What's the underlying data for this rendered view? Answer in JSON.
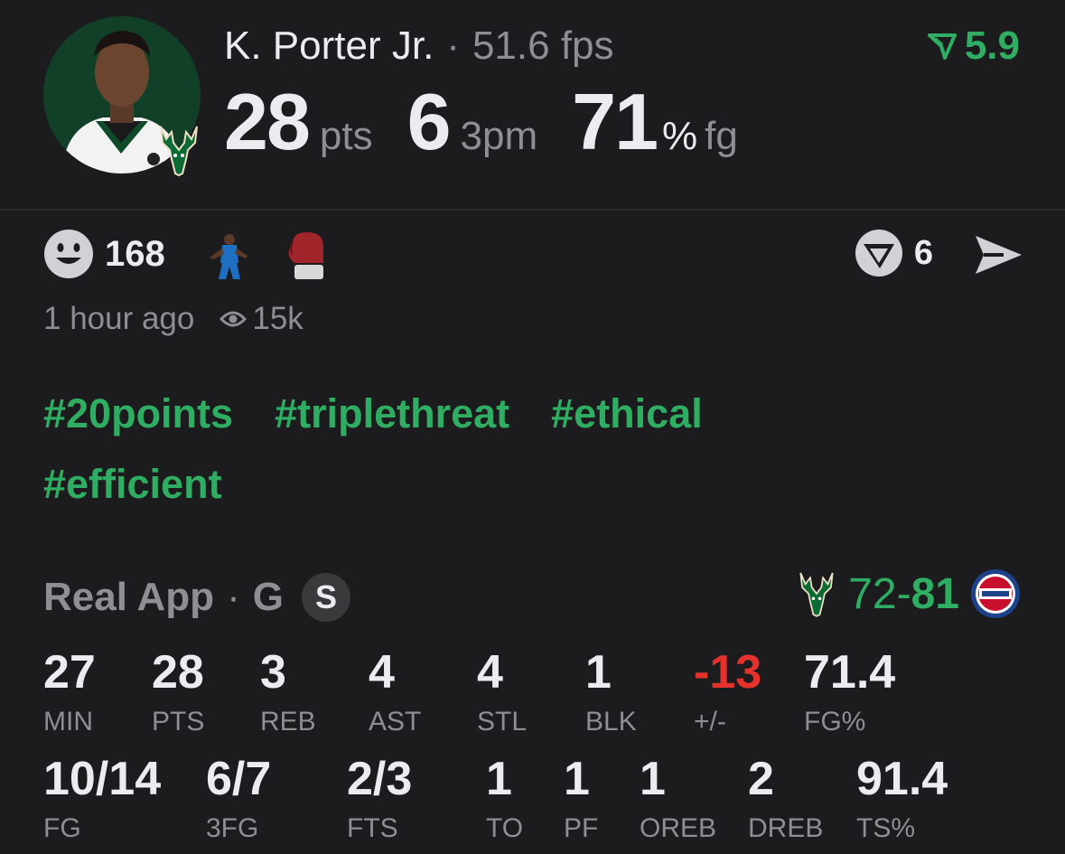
{
  "player": {
    "name": "K. Porter Jr.",
    "fps": "51.6 fps"
  },
  "rating": "5.9",
  "headline": {
    "pts_value": "28",
    "pts_unit": "pts",
    "threes_value": "6",
    "threes_unit": "3pm",
    "fg_value": "71",
    "fg_pct": "%",
    "fg_unit": "fg"
  },
  "reactions": {
    "count": "168"
  },
  "comments": {
    "count": "6"
  },
  "meta": {
    "time": "1 hour ago",
    "views": "15k"
  },
  "tags": [
    "#20points",
    "#triplethreat",
    "#ethical",
    "#efficient"
  ],
  "game": {
    "source": "Real App",
    "sep": "·",
    "position": "G",
    "badge": "S",
    "score_team": "72",
    "dash": "-",
    "score_opp": "81"
  },
  "stats_row1": [
    {
      "value": "27",
      "label": "MIN"
    },
    {
      "value": "28",
      "label": "PTS"
    },
    {
      "value": "3",
      "label": "REB"
    },
    {
      "value": "4",
      "label": "AST"
    },
    {
      "value": "4",
      "label": "STL"
    },
    {
      "value": "1",
      "label": "BLK"
    },
    {
      "value": "-13",
      "label": "+/-"
    },
    {
      "value": "71.4",
      "label": "FG%"
    }
  ],
  "stats_row2": [
    {
      "value": "10/14",
      "label": "FG"
    },
    {
      "value": "6/7",
      "label": "3FG"
    },
    {
      "value": "2/3",
      "label": "FTS"
    },
    {
      "value": "1",
      "label": "TO"
    },
    {
      "value": "1",
      "label": "PF"
    },
    {
      "value": "1",
      "label": "OREB"
    },
    {
      "value": "2",
      "label": "DREB"
    },
    {
      "value": "91.4",
      "label": "TS%"
    }
  ],
  "colors": {
    "accent": "#2fae63",
    "negative": "#e5322d",
    "muted": "#8e8e93",
    "bg": "#1c1c1e"
  },
  "icons": {
    "reaction": "smiley-icon",
    "views": "eye-icon",
    "comments": "comment-badge-icon",
    "share": "send-icon",
    "rating": "trend-down-icon",
    "team": "bucks-logo",
    "opponent": "pistons-logo"
  }
}
